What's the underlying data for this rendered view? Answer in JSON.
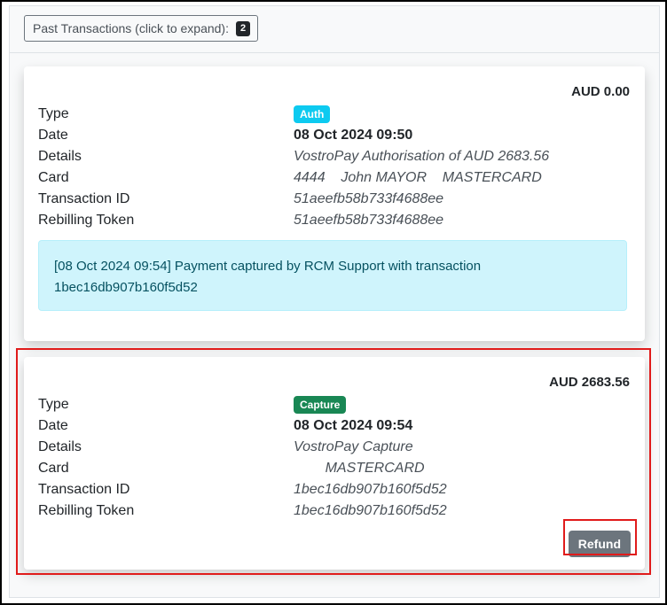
{
  "header": {
    "expand_label": "Past Transactions (click to expand):",
    "count": "2"
  },
  "transactions": [
    {
      "amount": "AUD 0.00",
      "type_label": "Type",
      "type_badge": "Auth",
      "date_label": "Date",
      "date": "08 Oct 2024 09:50",
      "details_label": "Details",
      "details": "VostroPay Authorisation of AUD 2683.56",
      "card_label": "Card",
      "card": "4444    John MAYOR    MASTERCARD",
      "txid_label": "Transaction ID",
      "txid": "51aeefb58b733f4688ee",
      "token_label": "Rebilling Token",
      "token": "51aeefb58b733f4688ee",
      "note_line1": "[08 Oct 2024 09:54] Payment captured by RCM Support with transaction",
      "note_line2": "1bec16db907b160f5d52"
    },
    {
      "amount": "AUD 2683.56",
      "type_label": "Type",
      "type_badge": "Capture",
      "date_label": "Date",
      "date": "08 Oct 2024 09:54",
      "details_label": "Details",
      "details": "VostroPay Capture",
      "card_label": "Card",
      "card": "        MASTERCARD",
      "txid_label": "Transaction ID",
      "txid": "1bec16db907b160f5d52",
      "token_label": "Rebilling Token",
      "token": "1bec16db907b160f5d52",
      "refund_label": "Refund"
    }
  ],
  "colors": {
    "auth_badge": "#0dcaf0",
    "capture_badge": "#198754",
    "refund_button": "#6c757d",
    "alert_bg": "#cff4fc",
    "highlight": "#e01b1b"
  }
}
